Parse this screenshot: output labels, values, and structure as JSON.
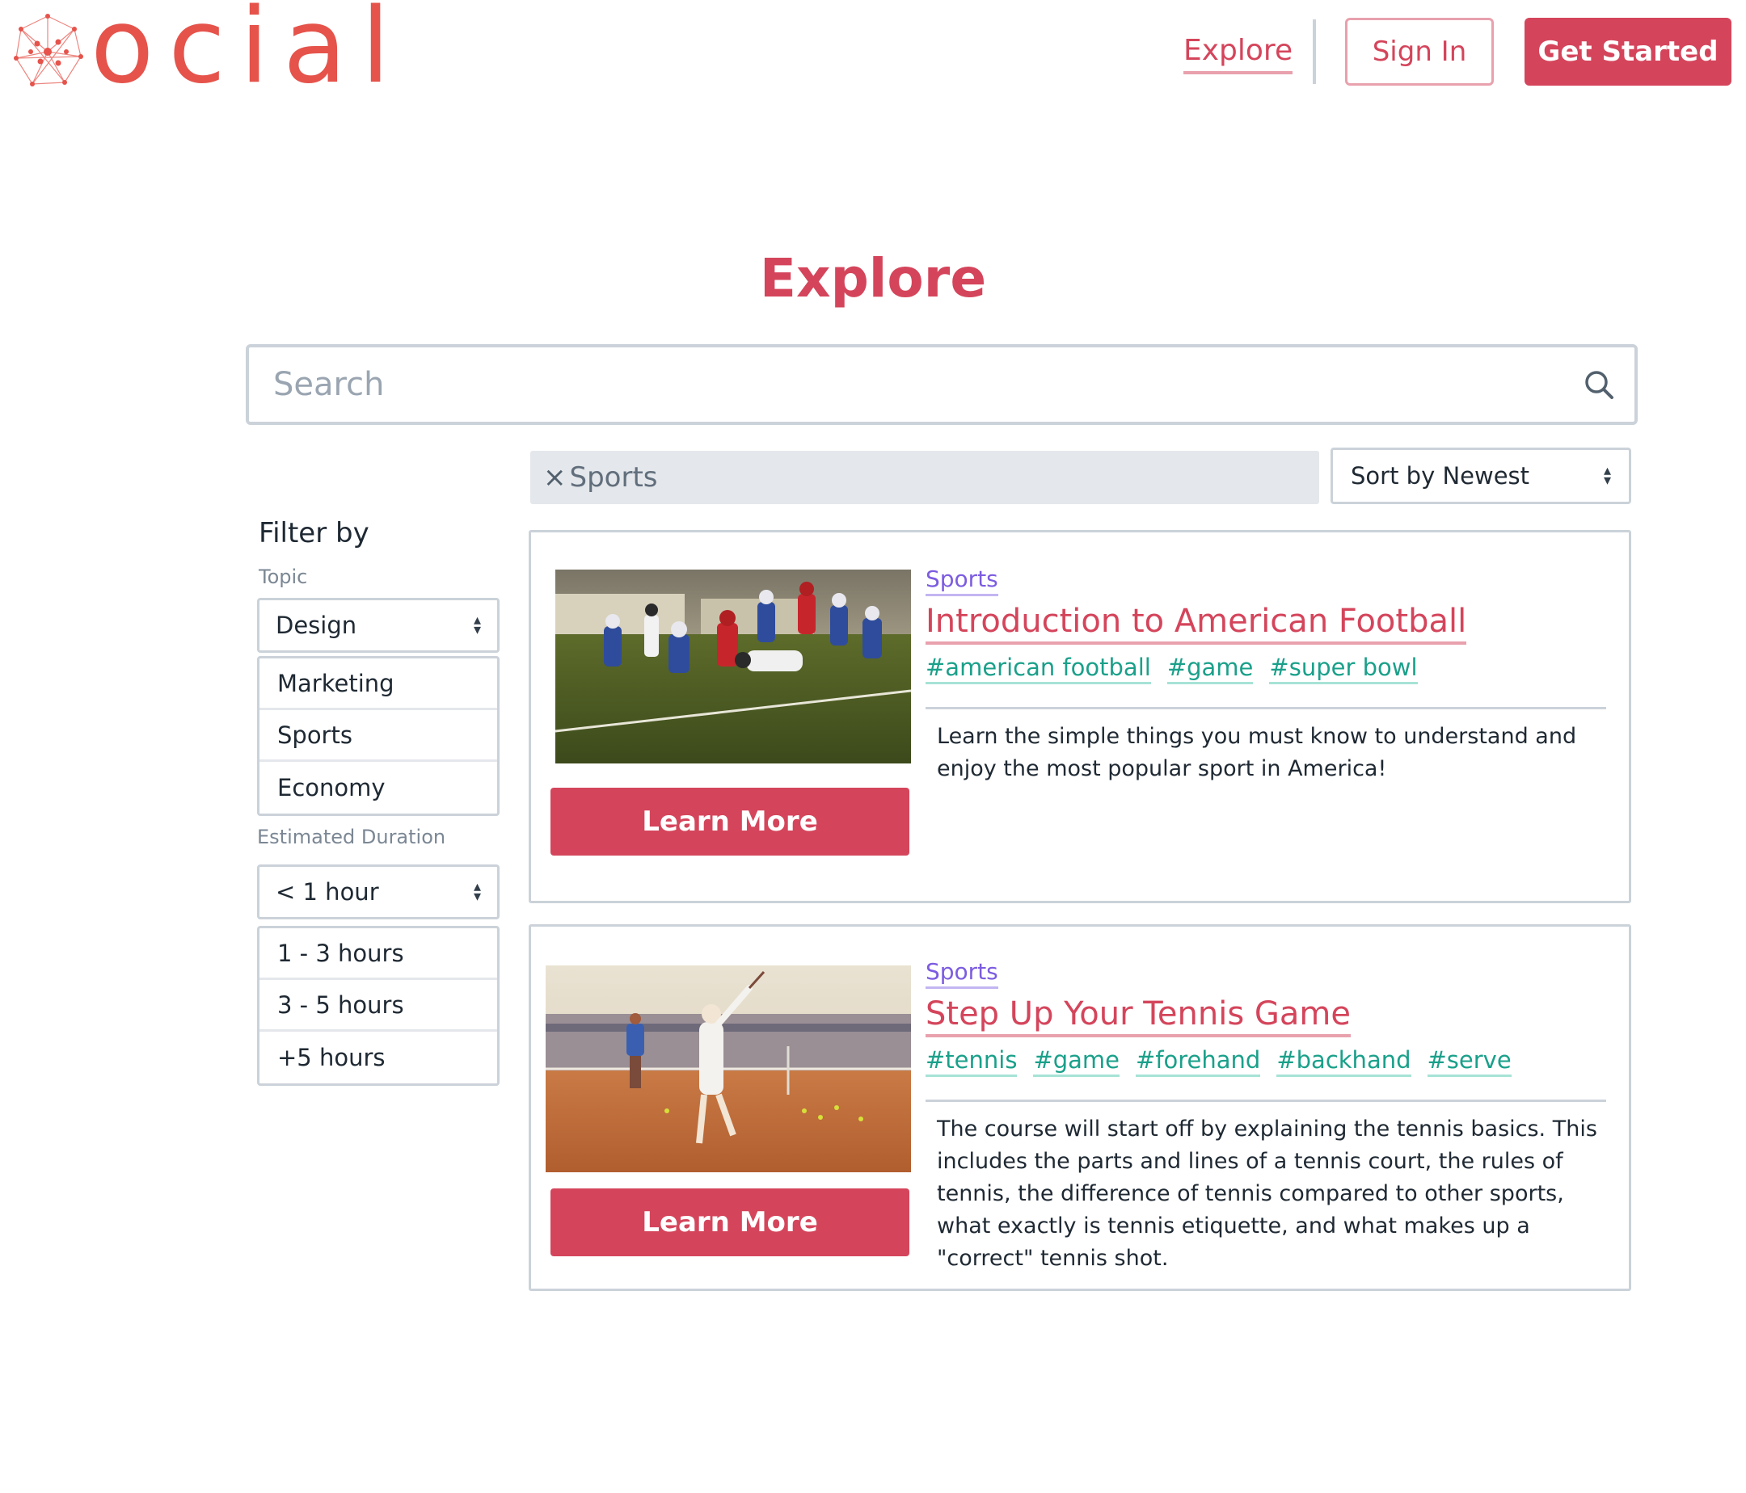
{
  "brand": {
    "logo_text": "ocial"
  },
  "header": {
    "explore_link": "Explore",
    "signin_label": "Sign In",
    "get_started_label": "Get Started"
  },
  "page": {
    "title": "Explore"
  },
  "search": {
    "placeholder": "Search"
  },
  "active_filter": {
    "remove_glyph": "×",
    "label": "Sports"
  },
  "sort": {
    "selected": "Sort by Newest"
  },
  "filters": {
    "title": "Filter by",
    "topic_label": "Topic",
    "topic_selected": "Design",
    "topic_options": [
      "Marketing",
      "Sports",
      "Economy"
    ],
    "duration_label": "Estimated Duration",
    "duration_selected": "< 1 hour",
    "duration_options": [
      "1 - 3 hours",
      "3 - 5 hours",
      "+5 hours"
    ]
  },
  "courses": [
    {
      "category": "Sports",
      "title": "Introduction to American Football",
      "tags": [
        "#american football",
        "#game",
        "#super bowl"
      ],
      "description": "Learn the simple things you must know to understand and enjoy the most popular sport in America!",
      "button_label": "Learn More"
    },
    {
      "category": "Sports",
      "title": "Step Up Your Tennis Game",
      "tags": [
        "#tennis",
        "#game",
        "#forehand",
        "#backhand",
        "#serve"
      ],
      "description": "The course will start off by explaining the tennis basics. This includes the parts and lines of a tennis court, the rules of tennis, the difference of tennis compared to other sports, what exactly is tennis etiquette, and what makes up a \"correct\" tennis shot.",
      "button_label": "Learn More"
    }
  ],
  "colors": {
    "brand": "#d4455b",
    "logo": "#e5534b",
    "category": "#7c5ce0",
    "tag": "#1aa08a",
    "border": "#cbd2d9"
  },
  "icons": {
    "logo_mark": "network-logo-icon",
    "search": "search-icon",
    "sort_arrows": "chevron-updown-icon",
    "remove_filter": "close-icon"
  }
}
